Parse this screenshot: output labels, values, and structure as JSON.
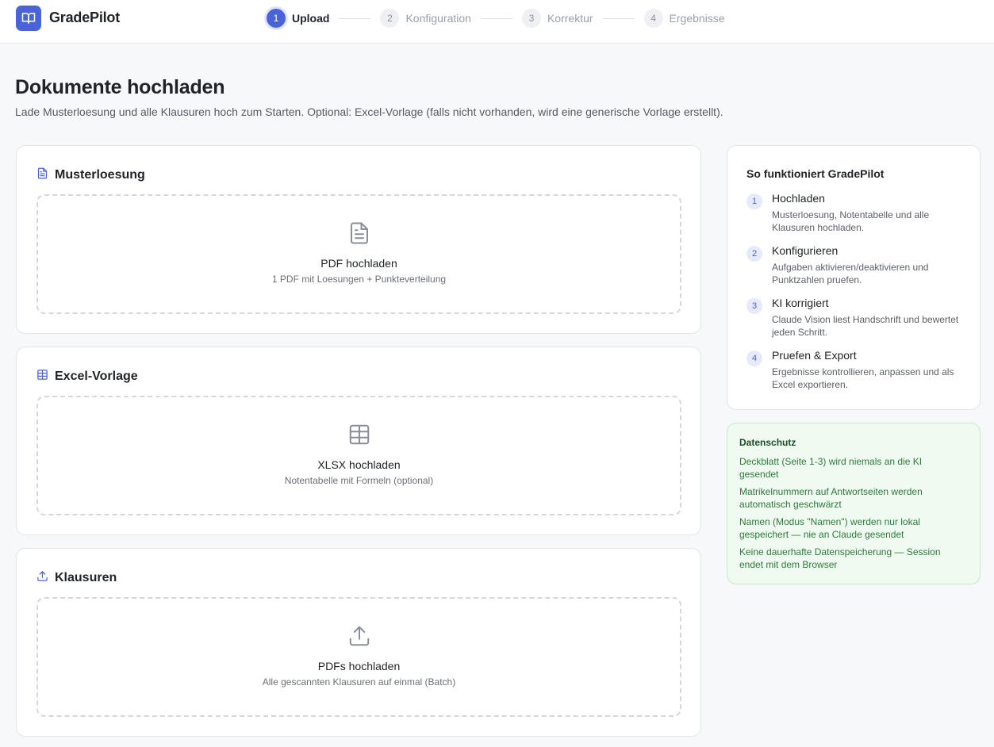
{
  "app": {
    "name": "GradePilot",
    "logo_icon": "book-open-icon",
    "accent": "#4b63d8"
  },
  "stepper": [
    {
      "num": "1",
      "label": "Upload",
      "active": true
    },
    {
      "num": "2",
      "label": "Konfiguration",
      "active": false
    },
    {
      "num": "3",
      "label": "Korrektur",
      "active": false
    },
    {
      "num": "4",
      "label": "Ergebnisse",
      "active": false
    }
  ],
  "page": {
    "title": "Dokumente hochladen",
    "subtitle": "Lade Musterloesung und alle Klausuren hoch zum Starten. Optional: Excel-Vorlage (falls nicht vorhanden, wird eine generische Vorlage erstellt)."
  },
  "cards": [
    {
      "icon": "file-text-icon",
      "title": "Musterloesung",
      "dz_title": "PDF hochladen",
      "dz_sub": "1 PDF mit Loesungen + Punkteverteilung"
    },
    {
      "icon": "table-icon",
      "title": "Excel-Vorlage",
      "dz_title": "XLSX hochladen",
      "dz_sub": "Notentabelle mit Formeln (optional)"
    },
    {
      "icon": "upload-icon",
      "title": "Klausuren",
      "dz_title": "PDFs hochladen",
      "dz_sub": "Alle gescannten Klausuren auf einmal (Batch)"
    }
  ],
  "howto": {
    "title": "So funktioniert GradePilot",
    "steps": [
      {
        "num": "1",
        "title": "Hochladen",
        "desc": "Musterloesung, Notentabelle und alle Klausuren hochladen."
      },
      {
        "num": "2",
        "title": "Konfigurieren",
        "desc": "Aufgaben aktivieren/deaktivieren und Punktzahlen pruefen."
      },
      {
        "num": "3",
        "title": "KI korrigiert",
        "desc": "Claude Vision liest Handschrift und bewertet jeden Schritt."
      },
      {
        "num": "4",
        "title": "Pruefen & Export",
        "desc": "Ergebnisse kontrollieren, anpassen und als Excel exportieren."
      }
    ]
  },
  "privacy": {
    "title": "Datenschutz",
    "color": "#2f7a3c",
    "items": [
      "Deckblatt (Seite 1-3) wird niemals an die KI gesendet",
      "Matrikelnummern auf Antwortseiten werden automatisch geschwärzt",
      "Namen (Modus \"Namen\") werden nur lokal gespeichert — nie an Claude gesendet",
      "Keine dauerhafte Datenspeicherung — Session endet mit dem Browser"
    ]
  }
}
